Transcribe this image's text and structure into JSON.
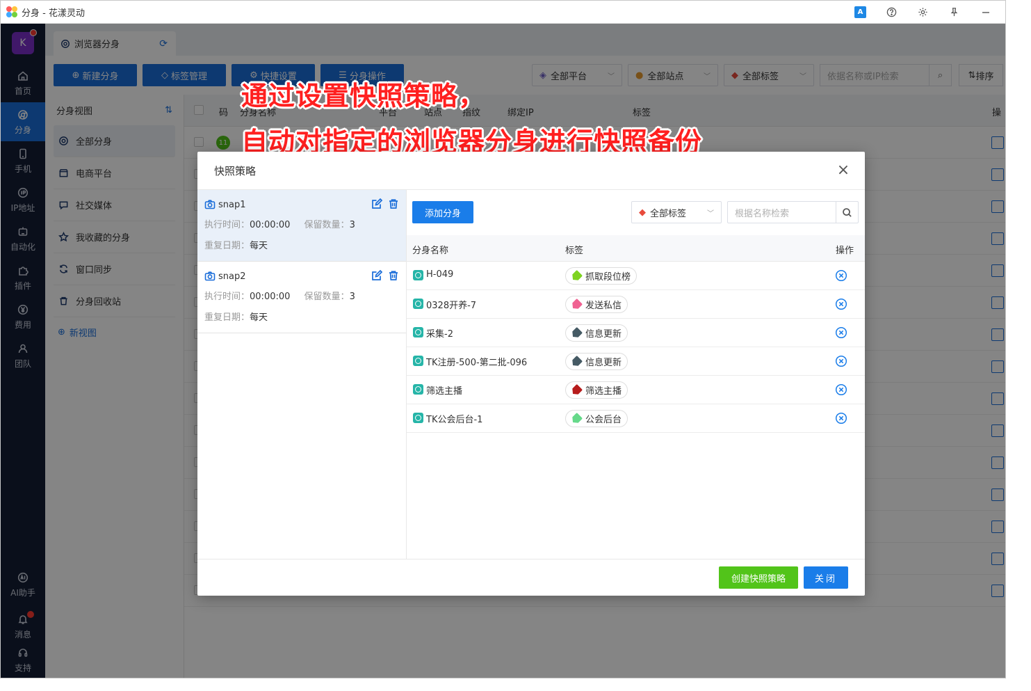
{
  "window": {
    "title": "分身 - 花漾灵动",
    "translate_label": "A"
  },
  "sidebar": {
    "avatar_letter": "K",
    "items": [
      {
        "label": "首页"
      },
      {
        "label": "分身"
      },
      {
        "label": "手机"
      },
      {
        "label": "IP地址"
      },
      {
        "label": "自动化"
      },
      {
        "label": "插件"
      },
      {
        "label": "费用"
      },
      {
        "label": "团队"
      }
    ],
    "bottom_items": [
      {
        "label": "AI助手"
      },
      {
        "label": "消息"
      },
      {
        "label": "支持"
      }
    ]
  },
  "main": {
    "tab_label": "浏览器分身",
    "toolbar": {
      "new_label": "新建分身",
      "tag_label": "标签管理",
      "fast_label": "快捷设置",
      "batch_label": "分身操作",
      "platform_label": "全部平台",
      "site_label": "全部站点",
      "tags_label": "全部标签",
      "search_placeholder": "依据名称或IP检索",
      "sort_label": "排序"
    },
    "left_panel": {
      "title": "分身视图",
      "items": [
        {
          "label": "全部分身"
        },
        {
          "label": "电商平台"
        },
        {
          "label": "社交媒体"
        },
        {
          "label": "我收藏的分身"
        },
        {
          "label": "窗口同步"
        },
        {
          "label": "分身回收站"
        }
      ],
      "new_view_label": "新视图"
    },
    "table_headers": {
      "code": "码",
      "name": "分身名称",
      "platform": "平台",
      "site": "站点",
      "fingerprint": "指纹",
      "ip": "绑定IP",
      "tags": "标签",
      "op": "操"
    },
    "first_row_badge": "11"
  },
  "caption": {
    "line1": "通过设置快照策略，",
    "line2": "自动对指定的浏览器分身进行快照备份"
  },
  "modal": {
    "title": "快照策略",
    "snapshots": [
      {
        "name": "snap1",
        "exec_label": "执行时间：",
        "exec_time": "00:00:00",
        "keep_label": "保留数量：",
        "keep_count": "3",
        "repeat_label": "重复日期：",
        "repeat": "每天"
      },
      {
        "name": "snap2",
        "exec_label": "执行时间：",
        "exec_time": "00:00:00",
        "keep_label": "保留数量：",
        "keep_count": "3",
        "repeat_label": "重复日期：",
        "repeat": "每天"
      }
    ],
    "add_button": "添加分身",
    "tag_filter": "全部标签",
    "search_placeholder": "根据名称检索",
    "headers": {
      "name": "分身名称",
      "tag": "标签",
      "action": "操作"
    },
    "rows": [
      {
        "name": "H-049",
        "tag": "抓取段位榜",
        "tag_color": "#7ed321"
      },
      {
        "name": "0328开养-7",
        "tag": "发送私信",
        "tag_color": "#f06292"
      },
      {
        "name": "采集-2",
        "tag": "信息更新",
        "tag_color": "#455a64"
      },
      {
        "name": "TK注册-500-第二批-096",
        "tag": "信息更新",
        "tag_color": "#455a64"
      },
      {
        "name": "筛选主播",
        "tag": "筛选主播",
        "tag_color": "#b71c1c"
      },
      {
        "name": "TK公会后台-1",
        "tag": "公会后台",
        "tag_color": "#66d98a"
      }
    ],
    "create_button": "创建快照策略",
    "close_button": "关闭"
  }
}
